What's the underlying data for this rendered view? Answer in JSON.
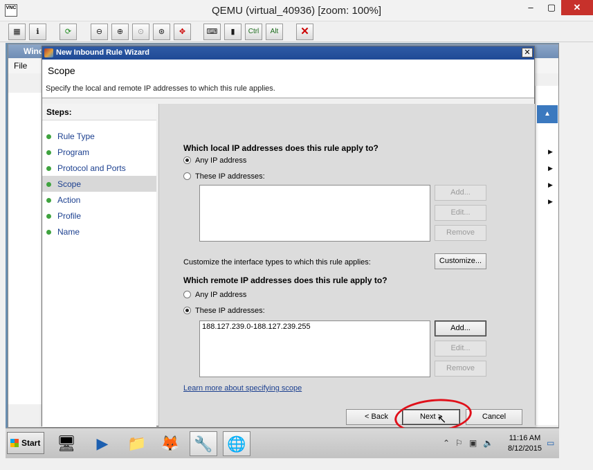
{
  "qemu": {
    "title": "QEMU (virtual_40936) [zoom: 100%]",
    "logo_text": "VNC",
    "controls": {
      "minimize": "–",
      "maximize": "▢",
      "close": "✕"
    },
    "toolbar": {
      "ctrl_label": "Ctrl",
      "alt_label": "Alt"
    }
  },
  "mmc": {
    "title": "Wind",
    "menu_file": "File"
  },
  "wizard": {
    "title": "New Inbound Rule Wizard",
    "header_title": "Scope",
    "header_subtitle": "Specify the local and remote IP addresses to which this rule applies.",
    "steps_heading": "Steps:",
    "steps": [
      {
        "label": "Rule Type",
        "active": false
      },
      {
        "label": "Program",
        "active": false
      },
      {
        "label": "Protocol and Ports",
        "active": false
      },
      {
        "label": "Scope",
        "active": true
      },
      {
        "label": "Action",
        "active": false
      },
      {
        "label": "Profile",
        "active": false
      },
      {
        "label": "Name",
        "active": false
      }
    ],
    "local": {
      "question": "Which local IP addresses does this rule apply to?",
      "option_any": "Any IP address",
      "option_these": "These IP addresses:",
      "selected": "any",
      "entries": [],
      "add_label": "Add...",
      "edit_label": "Edit...",
      "remove_label": "Remove"
    },
    "customize_text": "Customize the interface types to which this rule applies:",
    "customize_label": "Customize...",
    "remote": {
      "question": "Which remote IP addresses does this rule apply to?",
      "option_any": "Any IP address",
      "option_these": "These IP addresses:",
      "selected": "these",
      "entries": [
        "188.127.239.0-188.127.239.255"
      ],
      "add_label": "Add...",
      "edit_label": "Edit...",
      "remove_label": "Remove"
    },
    "learn_more": "Learn more about specifying scope",
    "back_label": "< Back",
    "next_label": "Next >",
    "cancel_label": "Cancel"
  },
  "taskbar": {
    "start_label": "Start",
    "time": "11:16 AM",
    "date": "8/12/2015"
  },
  "colors": {
    "wizard_title": "#1f4a96",
    "link": "#1b3f8f",
    "step_dot": "#3fa33f",
    "highlight_circle": "#e0101a"
  }
}
